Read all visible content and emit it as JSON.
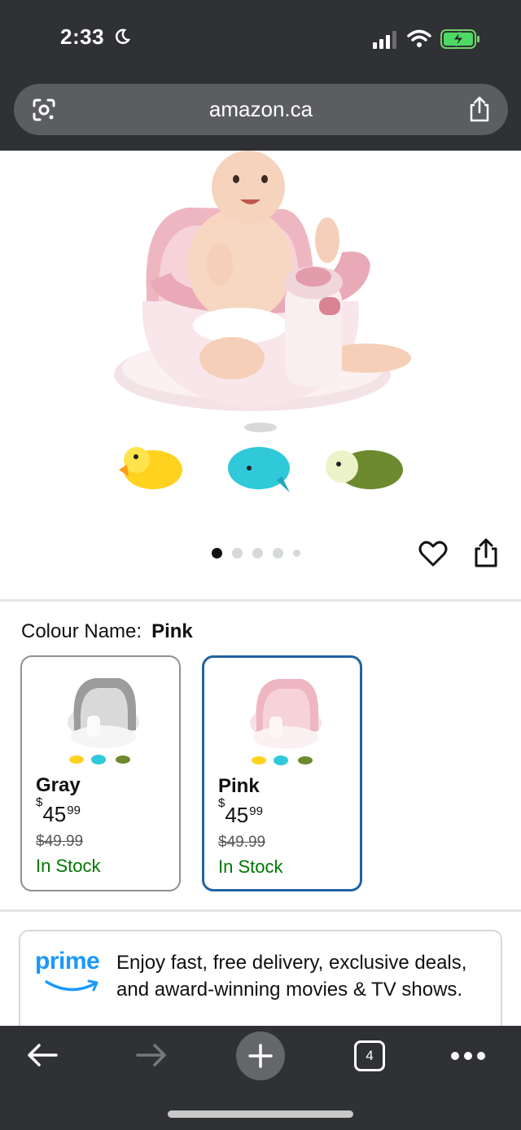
{
  "status": {
    "time": "2:33"
  },
  "browser": {
    "url": "amazon.ca",
    "tab_count": "4"
  },
  "gallery": {
    "total_images": 5,
    "active_index": 0
  },
  "colour": {
    "label": "Colour Name:",
    "selected": "Pink",
    "options": [
      {
        "name": "Gray",
        "currency": "$",
        "price_whole": "45",
        "price_cents": "99",
        "old_price": "$49.99",
        "stock": "In Stock",
        "selected": false
      },
      {
        "name": "Pink",
        "currency": "$",
        "price_whole": "45",
        "price_cents": "99",
        "old_price": "$49.99",
        "stock": "In Stock",
        "selected": true
      }
    ]
  },
  "prime": {
    "logo_text": "prime",
    "text": "Enjoy fast, free delivery, exclusive deals, and award-winning movies & TV shows."
  },
  "icons": [
    "moon-icon",
    "signal-icon",
    "wifi-icon",
    "battery-icon",
    "lens-icon",
    "share-icon",
    "heart-icon",
    "back-icon",
    "forward-icon",
    "plus-icon",
    "tabs-icon",
    "more-icon"
  ],
  "colors": {
    "accent_blue": "#2162a1",
    "prime_blue": "#1a98ff",
    "stock_green": "#007600",
    "bar_dark": "#2f3134"
  }
}
